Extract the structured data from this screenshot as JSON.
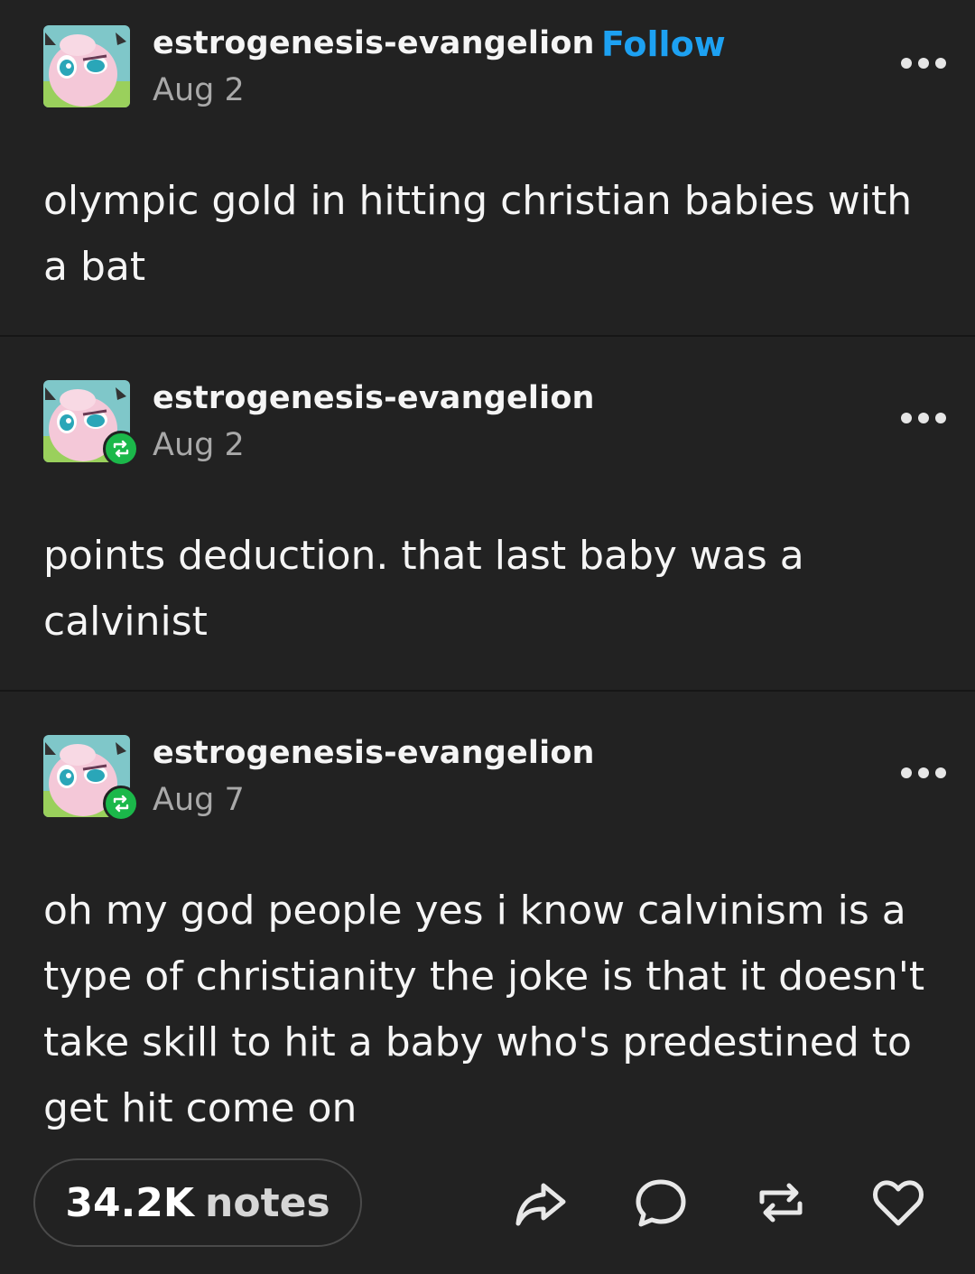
{
  "posts": [
    {
      "username": "estrogenesis-evangelion",
      "follow_label": "Follow",
      "date": "Aug 2",
      "text": "olympic gold in hitting christian babies with a bat",
      "is_reblog": false
    },
    {
      "username": "estrogenesis-evangelion",
      "date": "Aug 2",
      "text": "points deduction. that last baby was a calvinist",
      "is_reblog": true
    },
    {
      "username": "estrogenesis-evangelion",
      "date": "Aug 7",
      "text": "oh my god people yes i know calvinism is a type of christianity the joke is that it doesn't take skill to hit a baby who's predestined to get hit come on",
      "is_reblog": true
    }
  ],
  "footer": {
    "notes_count": "34.2K",
    "notes_label": "notes",
    "actions": [
      "share-icon",
      "comment-icon",
      "reblog-icon",
      "heart-icon"
    ]
  },
  "colors": {
    "background": "#222222",
    "follow": "#1da1f2",
    "reblog_badge": "#1bb84a",
    "secondary_text": "#a9a9a9"
  }
}
